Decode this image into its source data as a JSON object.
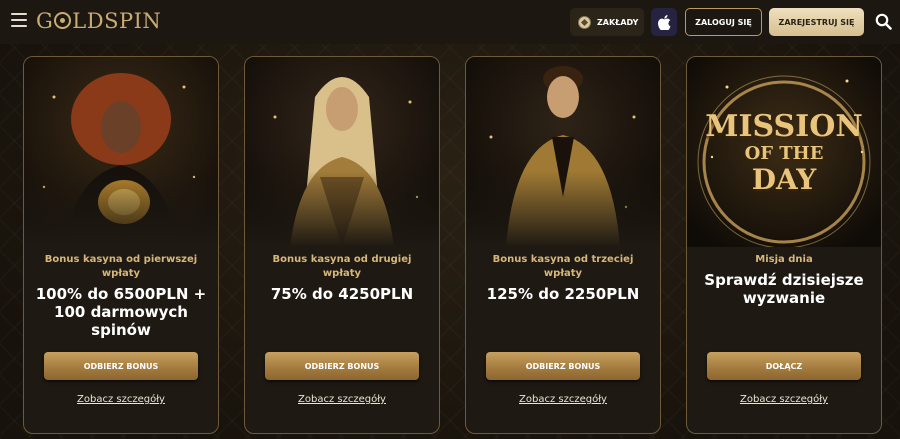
{
  "header": {
    "logo_text_left": "G",
    "logo_text_right": "LDSPIN",
    "zaklady_label": "ZAKŁADY",
    "login_label": "ZALOGUJ SIĘ",
    "register_label": "ZAREJESTRUJ SIĘ",
    "icons": [
      "menu-icon",
      "soccer-ball-icon",
      "apple-icon",
      "search-icon"
    ]
  },
  "cards": [
    {
      "subtitle": "Bonus kasyna od pierwszej wpłaty",
      "title": "100% do 6500PLN + 100 darmowych spinów",
      "button": "ODBIERZ BONUS",
      "link": "Zobacz szczegóły"
    },
    {
      "subtitle": "Bonus kasyna od drugiej wpłaty",
      "title": "75% do 4250PLN",
      "button": "ODBIERZ BONUS",
      "link": "Zobacz szczegóły"
    },
    {
      "subtitle": "Bonus kasyna od trzeciej wpłaty",
      "title": "125% do 2250PLN",
      "button": "ODBIERZ BONUS",
      "link": "Zobacz szczegóły"
    },
    {
      "subtitle": "Misja dnia",
      "title": "Sprawdź dzisiejsze wyzwanie",
      "button": "DOŁĄCZ",
      "link": "Zobacz szczegóły",
      "banner_line1": "MISSION",
      "banner_line2": "OF THE",
      "banner_line3": "DAY"
    }
  ],
  "colors": {
    "accent_gold": "#c9ab74",
    "button_gold": "#b08a4c",
    "register_bg": "#e6d3a9",
    "apple_bg": "#262342"
  }
}
